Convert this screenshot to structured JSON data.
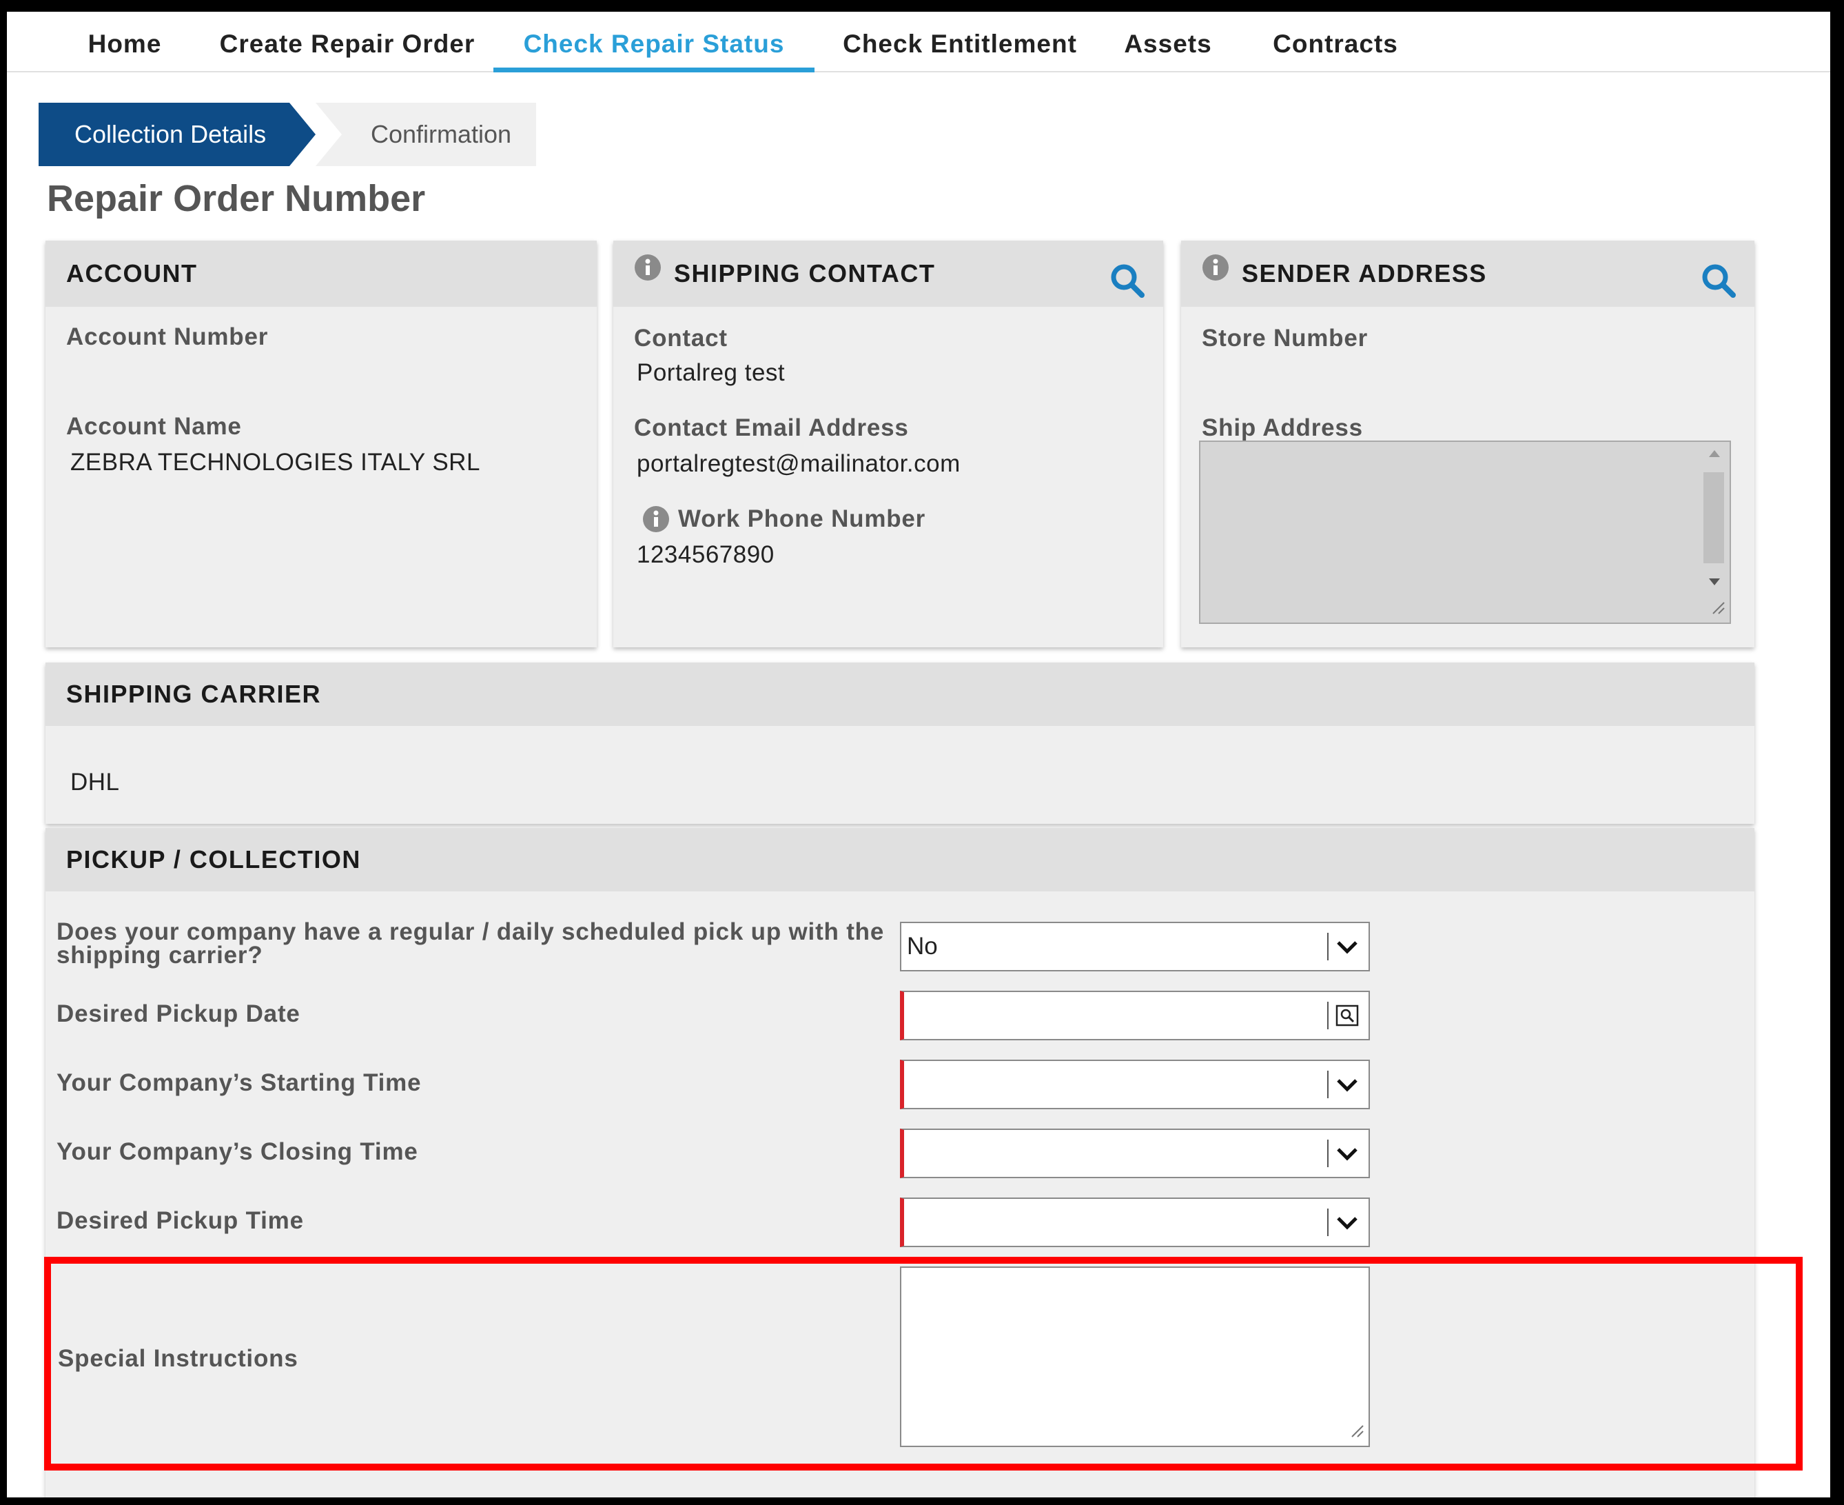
{
  "nav": {
    "items": [
      {
        "label": "Home"
      },
      {
        "label": "Create Repair Order"
      },
      {
        "label": "Check Repair Status"
      },
      {
        "label": "Check Entitlement"
      },
      {
        "label": "Assets"
      },
      {
        "label": "Contracts"
      }
    ],
    "active": "Check Repair Status",
    "active_color": "#2a9fd8"
  },
  "steps": {
    "current": "Collection Details",
    "next": "Confirmation",
    "current_color": "#0e4c87"
  },
  "page_title": "Repair Order Number",
  "account": {
    "heading": "ACCOUNT",
    "number_label": "Account Number",
    "number_value": "",
    "name_label": "Account Name",
    "name_value": "ZEBRA TECHNOLOGIES ITALY SRL"
  },
  "shipping_contact": {
    "heading": "SHIPPING CONTACT",
    "contact_label": "Contact",
    "contact_value": "Portalreg test",
    "email_label": "Contact Email Address",
    "email_value": "portalregtest@mailinator.com",
    "phone_label": "Work Phone Number",
    "phone_value": "1234567890"
  },
  "sender_address": {
    "heading": "SENDER ADDRESS",
    "store_label": "Store Number",
    "store_value": "",
    "ship_label": "Ship Address",
    "ship_value": ""
  },
  "shipping_carrier": {
    "heading": "SHIPPING CARRIER",
    "value": "DHL"
  },
  "pickup": {
    "heading": "PICKUP / COLLECTION",
    "regular_label_line1": "Does your company have a regular / daily scheduled pick up with the",
    "regular_label_line2": "shipping carrier?",
    "regular_value": "No",
    "date_label": "Desired Pickup Date",
    "date_value": "",
    "start_label": "Your Company’s Starting Time",
    "start_value": "",
    "close_label": "Your Company’s Closing Time",
    "close_value": "",
    "time_label": "Desired Pickup Time",
    "time_value": "",
    "instructions_label": "Special Instructions",
    "instructions_value": ""
  },
  "colors": {
    "required_marker": "#d9232a",
    "highlight": "#ff0000",
    "search_icon": "#1a7fc1"
  }
}
